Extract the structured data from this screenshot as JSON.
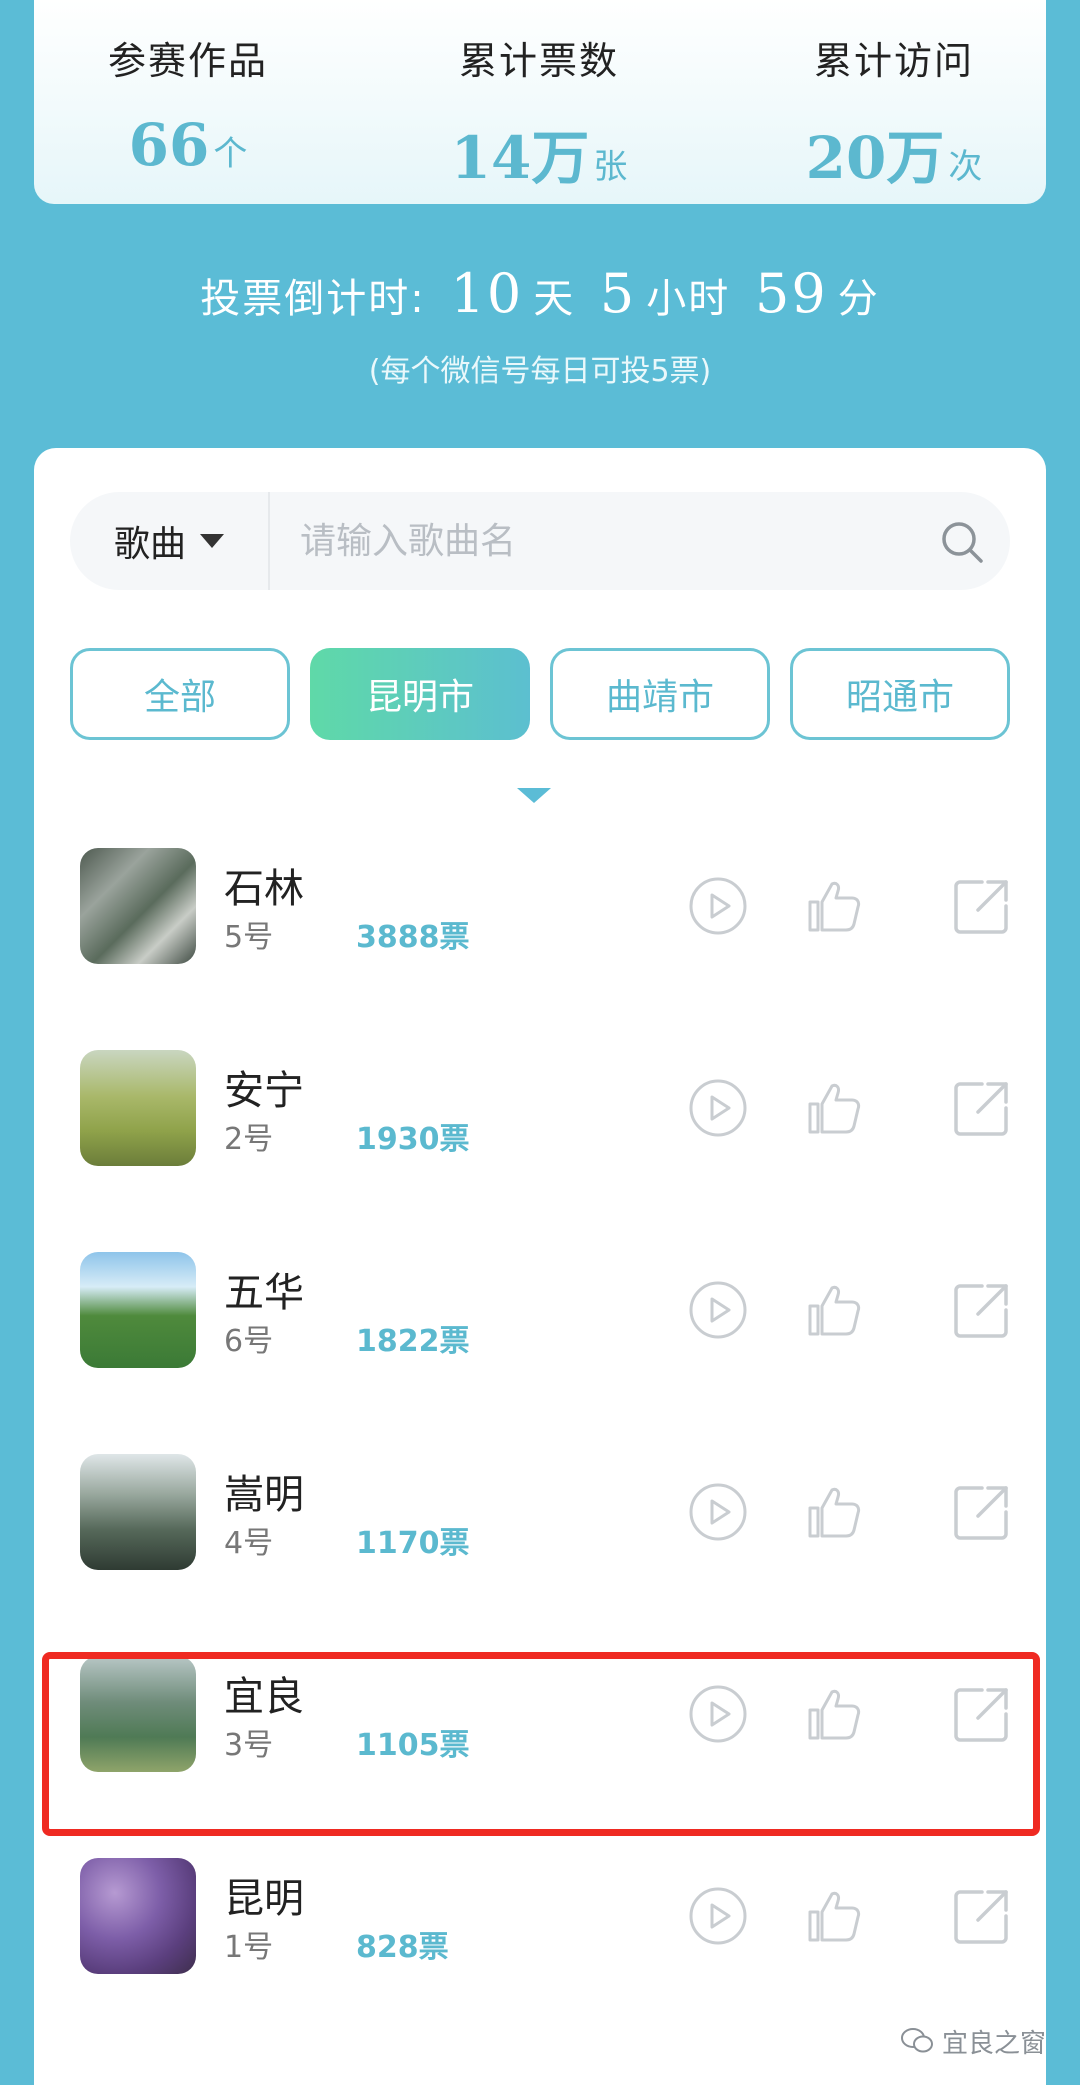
{
  "stats": [
    {
      "label": "参赛作品",
      "value": "66",
      "unit": "个"
    },
    {
      "label": "累计票数",
      "value": "14万",
      "unit": "张"
    },
    {
      "label": "累计访问",
      "value": "20万",
      "unit": "次"
    }
  ],
  "countdown": {
    "prefix": "投票倒计时:",
    "days": "10",
    "days_unit": "天",
    "hours": "5",
    "hours_unit": "小时",
    "minutes": "59",
    "minutes_unit": "分",
    "rule": "(每个微信号每日可投5票)"
  },
  "search": {
    "type_label": "歌曲",
    "placeholder": "请输入歌曲名",
    "icon": "search-icon"
  },
  "tabs": [
    {
      "label": "全部",
      "active": false
    },
    {
      "label": "昆明市",
      "active": true
    },
    {
      "label": "曲靖市",
      "active": false
    },
    {
      "label": "昭通市",
      "active": false
    }
  ],
  "songs": [
    {
      "name": "石林",
      "number": "5号",
      "votes": "3888票"
    },
    {
      "name": "安宁",
      "number": "2号",
      "votes": "1930票"
    },
    {
      "name": "五华",
      "number": "6号",
      "votes": "1822票"
    },
    {
      "name": "嵩明",
      "number": "4号",
      "votes": "1170票"
    },
    {
      "name": "宜良",
      "number": "3号",
      "votes": "1105票"
    },
    {
      "name": "昆明",
      "number": "1号",
      "votes": "828票"
    }
  ],
  "actions": [
    "play-icon",
    "thumbs-up-icon",
    "share-icon"
  ],
  "colors": {
    "accent": "#5bbcd6",
    "highlight": "#ef2a22",
    "tab_gradient_start": "#5fd9a8"
  },
  "watermark": "宜良之窗"
}
